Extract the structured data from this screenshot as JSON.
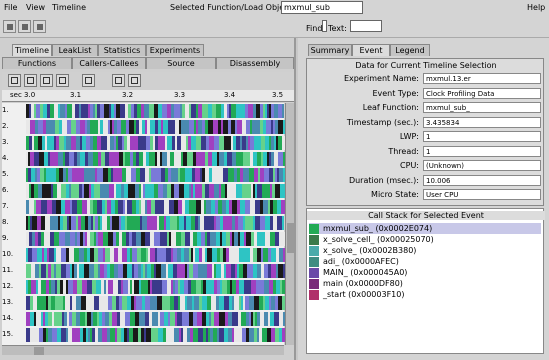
{
  "menu": {
    "items": [
      "File",
      "View",
      "Timeline"
    ],
    "help": "Help"
  },
  "selected_object": {
    "label": "Selected Function/Load Object:",
    "value": "mxmul_sub"
  },
  "find": {
    "label": "Find",
    "text_label": "Text:"
  },
  "left_tabs_row1": [
    "Timeline",
    "LeakList",
    "Statistics",
    "Experiments"
  ],
  "left_tabs_row2": [
    "Functions",
    "Callers-Callees",
    "Source",
    "Disassembly"
  ],
  "ruler_ticks": [
    "sec 3.0",
    "3.1",
    "3.2",
    "3.3",
    "3.4",
    "3.5"
  ],
  "rows": [
    "1.",
    "2.",
    "3.",
    "4.",
    "5.",
    "6.",
    "7.",
    "8.",
    "9.",
    "10.",
    "11.",
    "12.",
    "13.",
    "14.",
    "15."
  ],
  "right_tabs": [
    "Summary",
    "Event",
    "Legend"
  ],
  "event": {
    "title": "Data for Current Timeline Selection",
    "fields": [
      {
        "label": "Experiment Name:",
        "value": "mxmul.13.er"
      },
      {
        "label": "Event Type:",
        "value": "Clock Profiling Data"
      },
      {
        "label": "Leaf Function:",
        "value": "mxmul_sub_"
      },
      {
        "label": "Timestamp (sec.):",
        "value": "3.435834"
      },
      {
        "label": "LWP:",
        "value": "1"
      },
      {
        "label": "Thread:",
        "value": "1"
      },
      {
        "label": "CPU:",
        "value": "(Unknown)"
      },
      {
        "label": "Duration (msec.):",
        "value": "10.006"
      },
      {
        "label": "Micro State:",
        "value": "User CPU"
      }
    ]
  },
  "stack": {
    "title": "Call Stack for Selected Event",
    "items": [
      {
        "label": "mxmul_sub_ (0x0002E074)",
        "color": "#22aa55",
        "selected": true
      },
      {
        "label": "x_solve_cell_ (0x00025070)",
        "color": "#3a7a4a",
        "selected": false
      },
      {
        "label": "x_solve_ (0x0002B380)",
        "color": "#4aaaaa",
        "selected": false
      },
      {
        "label": "adi_ (0x0000AFEC)",
        "color": "#3f8c82",
        "selected": false
      },
      {
        "label": "MAIN_ (0x000045A0)",
        "color": "#6b4aa8",
        "selected": false
      },
      {
        "label": "main (0x0000DF80)",
        "color": "#7a2a7a",
        "selected": false
      },
      {
        "label": "_start (0x00003F10)",
        "color": "#b0306a",
        "selected": false
      }
    ]
  },
  "colors": {
    "palette": [
      "#2ec4c4",
      "#22aa55",
      "#3a3a8a",
      "#7a7ad8",
      "#e8e8e8",
      "#1a1a1a",
      "#a040c0",
      "#66d28a",
      "#4a8ab0"
    ]
  }
}
